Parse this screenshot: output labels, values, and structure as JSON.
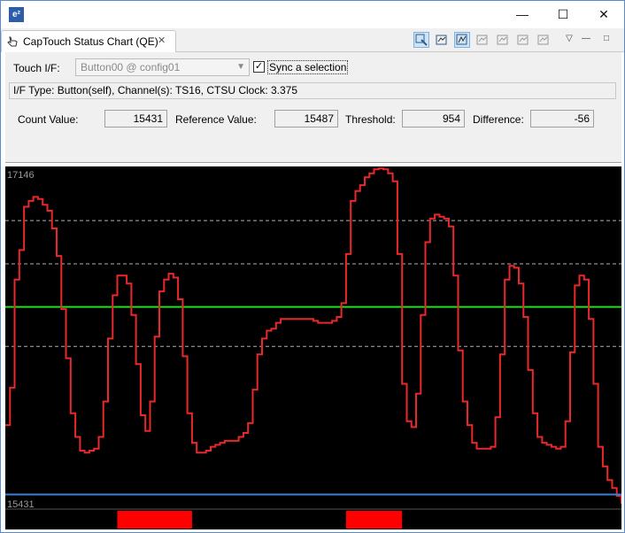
{
  "window": {
    "app_icon": "e²",
    "controls": {
      "minimize": "—",
      "maximize": "☐",
      "close": "✕"
    }
  },
  "tab": {
    "title": "CapTouch Status Chart (QE)",
    "close_glyph": "✕"
  },
  "toolbar": {
    "icons": [
      "touch-select-icon",
      "chart-view-icon",
      "chart-auto-icon",
      "chart-1-icon",
      "chart-2-icon",
      "chart-3-icon",
      "chart-4-icon"
    ],
    "menu_glyph": "▽",
    "minimize_glyph": "—",
    "maximize_glyph": "□"
  },
  "form": {
    "touch_if_label": "Touch I/F:",
    "touch_if_value": "Button00 @ config01",
    "sync_checked_glyph": "✓",
    "sync_label": "Sync a selection",
    "info": "I/F Type: Button(self), Channel(s): TS16, CTSU Clock: 3.375",
    "count_label": "Count Value:",
    "count_value": "15431",
    "reference_label": "Reference Value:",
    "reference_value": "15487",
    "threshold_label": "Threshold:",
    "threshold_value": "954",
    "difference_label": "Difference:",
    "difference_value": "-56"
  },
  "chart_data": {
    "type": "line",
    "ymax_label": "17146",
    "ymin_label": "15431",
    "ylim": [
      15431,
      17146
    ],
    "colors": {
      "count": "#e8282a",
      "threshold": "#22dd22",
      "reference": "#3a7fd8",
      "touch": "#ff0000",
      "grid": "#b0b0b0"
    },
    "threshold_level": 16441,
    "reference_level": 15487,
    "gridlines": [
      16880,
      16660,
      16240
    ],
    "series": [
      {
        "values": [
          15840,
          16030,
          16580,
          16730,
          16950,
          16980,
          17000,
          16990,
          16960,
          16930,
          16840,
          16700,
          16430,
          16180,
          15900,
          15780,
          15710,
          15700,
          15710,
          15720,
          15780,
          15960,
          16280,
          16500,
          16600,
          16600,
          16560,
          16400,
          16150,
          15890,
          15810,
          15960,
          16290,
          16520,
          16580,
          16610,
          16590,
          16480,
          16190,
          15900,
          15750,
          15700,
          15700,
          15710,
          15730,
          15740,
          15750,
          15760,
          15760,
          15760,
          15780,
          15800,
          15850,
          16020,
          16200,
          16280,
          16320,
          16330,
          16360,
          16380,
          16380,
          16380,
          16380,
          16380,
          16380,
          16380,
          16370,
          16360,
          16360,
          16360,
          16370,
          16390,
          16460,
          16710,
          16980,
          17030,
          17060,
          17100,
          17120,
          17140,
          17145,
          17140,
          17120,
          17080,
          16710,
          16050,
          15860,
          15830,
          16000,
          16400,
          16770,
          16890,
          16910,
          16900,
          16890,
          16850,
          16600,
          16220,
          15960,
          15840,
          15750,
          15720,
          15720,
          15720,
          15730,
          15880,
          16200,
          16580,
          16650,
          16640,
          16560,
          16390,
          16120,
          15900,
          15780,
          15750,
          15740,
          15730,
          15720,
          15730,
          15860,
          16210,
          16550,
          16600,
          16580,
          16380,
          16050,
          15730,
          15630,
          15560,
          15520,
          15480,
          15440
        ]
      },
      {
        "values": [
          0,
          0,
          0,
          0,
          0,
          0,
          0,
          0,
          0,
          0,
          0,
          0,
          0,
          0,
          0,
          0,
          0,
          0,
          0,
          0,
          0,
          0,
          0,
          0,
          1,
          1,
          1,
          1,
          1,
          1,
          1,
          1,
          1,
          1,
          1,
          1,
          1,
          1,
          1,
          1,
          0,
          0,
          0,
          0,
          0,
          0,
          0,
          0,
          0,
          0,
          0,
          0,
          0,
          0,
          0,
          0,
          0,
          0,
          0,
          0,
          0,
          0,
          0,
          0,
          0,
          0,
          0,
          0,
          0,
          0,
          0,
          0,
          0,
          1,
          1,
          1,
          1,
          1,
          1,
          1,
          1,
          1,
          1,
          1,
          1,
          0,
          0,
          0,
          0,
          0,
          0,
          0,
          0,
          0,
          0,
          0,
          0,
          0,
          0,
          0,
          0,
          0,
          0,
          0,
          0,
          0,
          0,
          0,
          0,
          0,
          0,
          0,
          0,
          0,
          0,
          0,
          0,
          0,
          0,
          0,
          0,
          0,
          0,
          0,
          0,
          0,
          0,
          0,
          0,
          0,
          0,
          0
        ]
      }
    ]
  }
}
